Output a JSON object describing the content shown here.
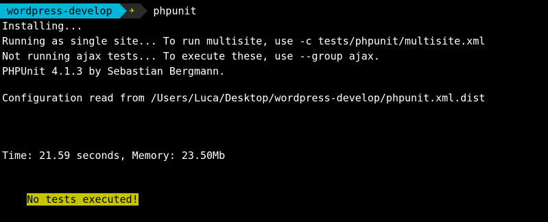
{
  "prompt": {
    "directory": "wordpress-develop",
    "icon": "✈",
    "command": "phpunit"
  },
  "output": {
    "line1": "Installing...",
    "line2": "Running as single site... To run multisite, use -c tests/phpunit/multisite.xml",
    "line3": "Not running ajax tests... To execute these, use --group ajax.",
    "line4": "PHPUnit 4.1.3 by Sebastian Bergmann.",
    "line5": "Configuration read from /Users/Luca/Desktop/wordpress-develop/phpunit.xml.dist",
    "line6": "Time: 21.59 seconds, Memory: 23.50Mb",
    "line7": "No tests executed!"
  },
  "colors": {
    "background": "#000000",
    "text": "#ffffff",
    "prompt_directory_bg": "#00b6d9",
    "highlight_bg": "#c6c600"
  }
}
